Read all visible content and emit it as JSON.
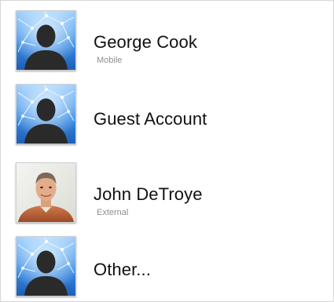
{
  "users": [
    {
      "name": "George Cook",
      "subtitle": "Mobile",
      "avatar_icon": "generic-user-silhouette-icon"
    },
    {
      "name": "Guest Account",
      "subtitle": "",
      "avatar_icon": "generic-user-silhouette-icon"
    },
    {
      "name": "John DeTroye",
      "subtitle": "External",
      "avatar_icon": "user-photo-avatar"
    },
    {
      "name": "Other...",
      "subtitle": "",
      "avatar_icon": "generic-user-silhouette-icon"
    }
  ],
  "colors": {
    "name_text": "#111111",
    "subtitle_text": "#8f8f8f",
    "silhouette_bg": "#2f7fd8",
    "silhouette_fg": "#2a2a2a"
  }
}
